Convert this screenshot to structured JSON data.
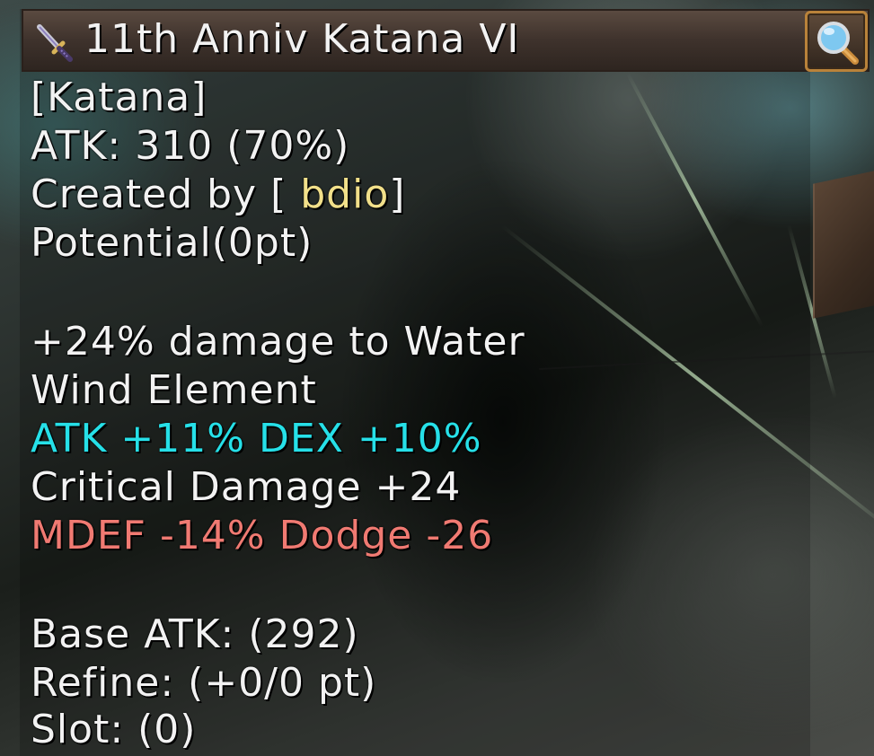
{
  "item": {
    "name": "11th Anniv Katana VI",
    "type": "[Katana]",
    "atk": "ATK: 310 (70%)",
    "created_by_prefix": "Created by [",
    "creator": " bdio",
    "created_by_suffix": "]",
    "potential": "Potential(0pt)",
    "effect_line_1": "+24% damage to Water",
    "effect_line_2": "Wind Element",
    "bonus_stats": "ATK +11% DEX +10%",
    "critical": "Critical Damage +24",
    "penalty_stats": "MDEF -14% Dodge -26",
    "base_atk": "Base ATK: (292)",
    "refine": "Refine: (+0/0 pt)",
    "slot": "Slot: (0)"
  },
  "icons": {
    "item_icon": "katana-icon",
    "inspect_icon": "magnifier-icon"
  },
  "colors": {
    "default_text": "#f2f2f2",
    "bonus_text": "#26e0e8",
    "penalty_text": "#f07a72",
    "creator_text": "#f2e08a",
    "button_border": "#b9823a"
  }
}
